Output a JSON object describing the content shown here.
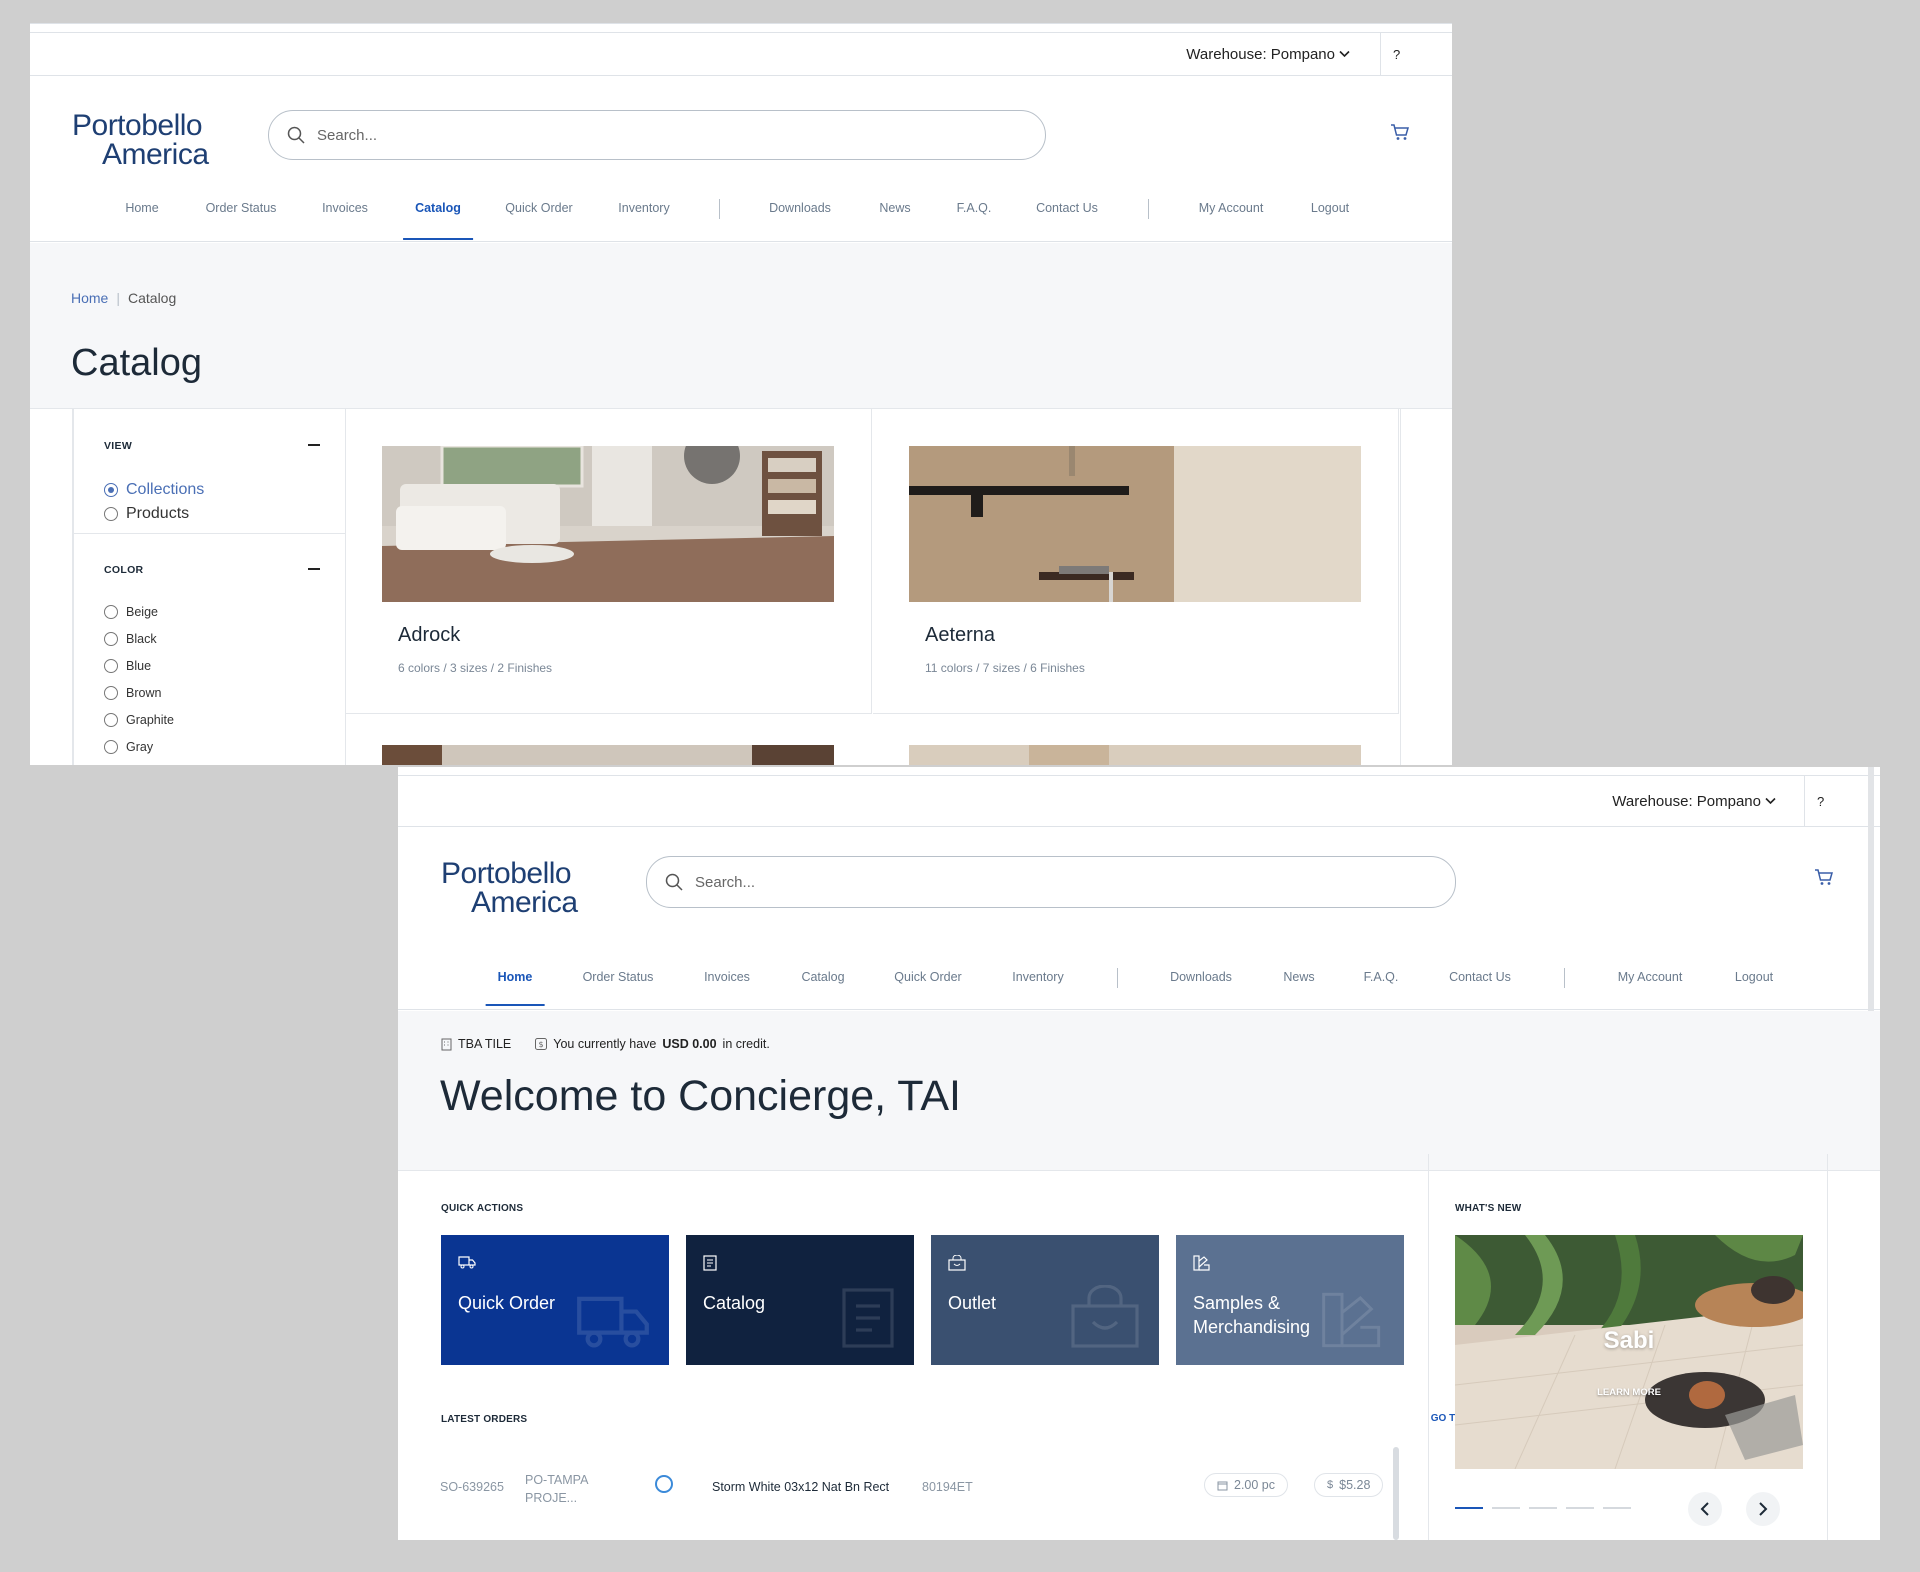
{
  "common": {
    "warehouse_label": "Warehouse: Pompano",
    "help": "?",
    "logo_line1": "Portobello",
    "logo_line2": "America",
    "search_placeholder": "Search...",
    "nav": [
      "Home",
      "Order Status",
      "Invoices",
      "Catalog",
      "Quick Order",
      "Inventory",
      "Downloads",
      "News",
      "F.A.Q.",
      "Contact Us",
      "My Account",
      "Logout"
    ],
    "accent": "#1a56b8"
  },
  "catalog_window": {
    "active_nav": "Catalog",
    "breadcrumb": {
      "home": "Home",
      "current": "Catalog"
    },
    "title": "Catalog",
    "filters": {
      "view": {
        "heading": "VIEW",
        "options": [
          "Collections",
          "Products"
        ],
        "selected": "Collections"
      },
      "color": {
        "heading": "COLOR",
        "options": [
          "Beige",
          "Black",
          "Blue",
          "Brown",
          "Graphite",
          "Gray"
        ]
      }
    },
    "cards": [
      {
        "name": "Adrock",
        "meta": "6 colors / 3 sizes / 2 Finishes"
      },
      {
        "name": "Aeterna",
        "meta": "11 colors / 7 sizes / 6 Finishes"
      }
    ]
  },
  "home_window": {
    "active_nav": "Home",
    "account_name": "TBA TILE",
    "credit_prefix": "You currently have",
    "credit_amount": "USD 0.00",
    "credit_suffix": "in credit.",
    "welcome": "Welcome to Concierge, TAI",
    "quick_actions_heading": "QUICK ACTIONS",
    "quick_actions": [
      {
        "label": "Quick Order",
        "color": "#0a3592",
        "icon": "truck-icon"
      },
      {
        "label": "Catalog",
        "color": "#10223f",
        "icon": "book-icon"
      },
      {
        "label": "Outlet",
        "color": "#3a5070",
        "icon": "shop-bag-icon"
      },
      {
        "label": "Samples & Merchandising",
        "color": "#5b7191",
        "icon": "swatch-icon"
      }
    ],
    "latest_orders_heading": "LATEST ORDERS",
    "go_to_order_status": "GO TO ORDER STATUS",
    "orders": [
      {
        "so": "SO-639265",
        "po": "PO-TAMPA PROJE...",
        "product": "Storm White 03x12 Nat Bn Rect",
        "sku": "80194ET",
        "qty": "2.00 pc",
        "price_symbol": "$",
        "price": "$5.28"
      }
    ],
    "whats_new_heading": "WHAT'S NEW",
    "news": {
      "title": "Sabi",
      "cta": "LEARN MORE",
      "slide_count": 5,
      "active_slide": 1
    }
  }
}
